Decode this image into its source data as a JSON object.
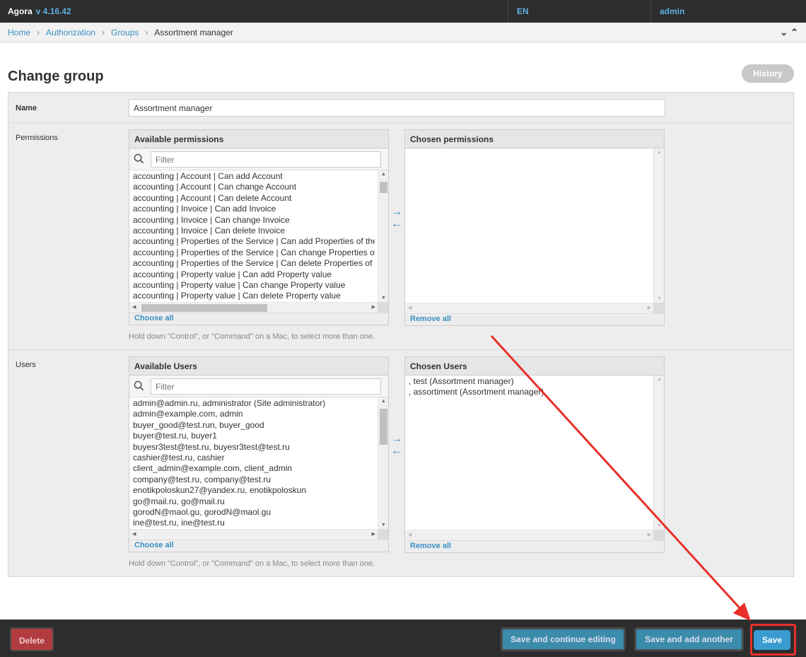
{
  "topbar": {
    "brand": "Agora",
    "version": "v 4.16.42",
    "language": "EN",
    "user": "admin"
  },
  "breadcrumbs": [
    "Home",
    "Authorization",
    "Groups"
  ],
  "breadcrumb_current": "Assortment manager",
  "page": {
    "title": "Change group",
    "history_label": "History"
  },
  "form": {
    "name_label": "Name",
    "name_value": "Assortment manager",
    "permissions_label": "Permissions",
    "users_label": "Users",
    "help_text": "Hold down \"Control\", or \"Command\" on a Mac, to select more than one."
  },
  "permissions": {
    "available_title": "Available permissions",
    "chosen_title": "Chosen permissions",
    "filter_placeholder": "Filter",
    "choose_all": "Choose all",
    "remove_all": "Remove all",
    "available": [
      "accounting | Account | Can add Account",
      "accounting | Account | Can change Account",
      "accounting | Account | Can delete Account",
      "accounting | Invoice | Can add Invoice",
      "accounting | Invoice | Can change Invoice",
      "accounting | Invoice | Can delete Invoice",
      "accounting | Properties of the Service | Can add Properties of the",
      "accounting | Properties of the Service | Can change Properties of",
      "accounting | Properties of the Service | Can delete Properties of t",
      "accounting | Property value | Can add Property value",
      "accounting | Property value | Can change Property value",
      "accounting | Property value | Can delete Property value"
    ],
    "chosen": []
  },
  "users": {
    "available_title": "Available Users",
    "chosen_title": "Chosen Users",
    "filter_placeholder": "Filter",
    "choose_all": "Choose all",
    "remove_all": "Remove all",
    "available": [
      "admin@admin.ru, administrator (Site administrator)",
      "admin@example.com, admin",
      "buyer_good@test.run, buyer_good",
      "buyer@test.ru, buyer1",
      "buyesr3test@test.ru, buyesr3test@test.ru",
      "cashier@test.ru, cashier",
      "client_admin@example.com, client_admin",
      "company@test.ru, company@test.ru",
      "enotikpoloskun27@yandex.ru, enotikpoloskun",
      "go@mail.ru, go@mail.ru",
      "gorodN@maol.gu, gorodN@maol.gu",
      "ine@test.ru, ine@test.ru"
    ],
    "chosen": [
      ", test (Assortment manager)",
      ", assortiment (Assortment manager)"
    ]
  },
  "actions": {
    "delete": "Delete",
    "save_continue": "Save and continue editing",
    "save_another": "Save and add another",
    "save": "Save"
  },
  "colors": {
    "link": "#3a8fc4",
    "topbar_bg": "#2d2d2d",
    "delete_bg": "#b13c40",
    "save_bg": "#3a9bd0",
    "annotation_red": "#e8302a"
  },
  "icons": {
    "search": "magnifier-icon",
    "move_right": "arrow-right-icon",
    "move_left": "arrow-left-icon",
    "breadcrumbs_toggle": "double-chevron-icon"
  }
}
